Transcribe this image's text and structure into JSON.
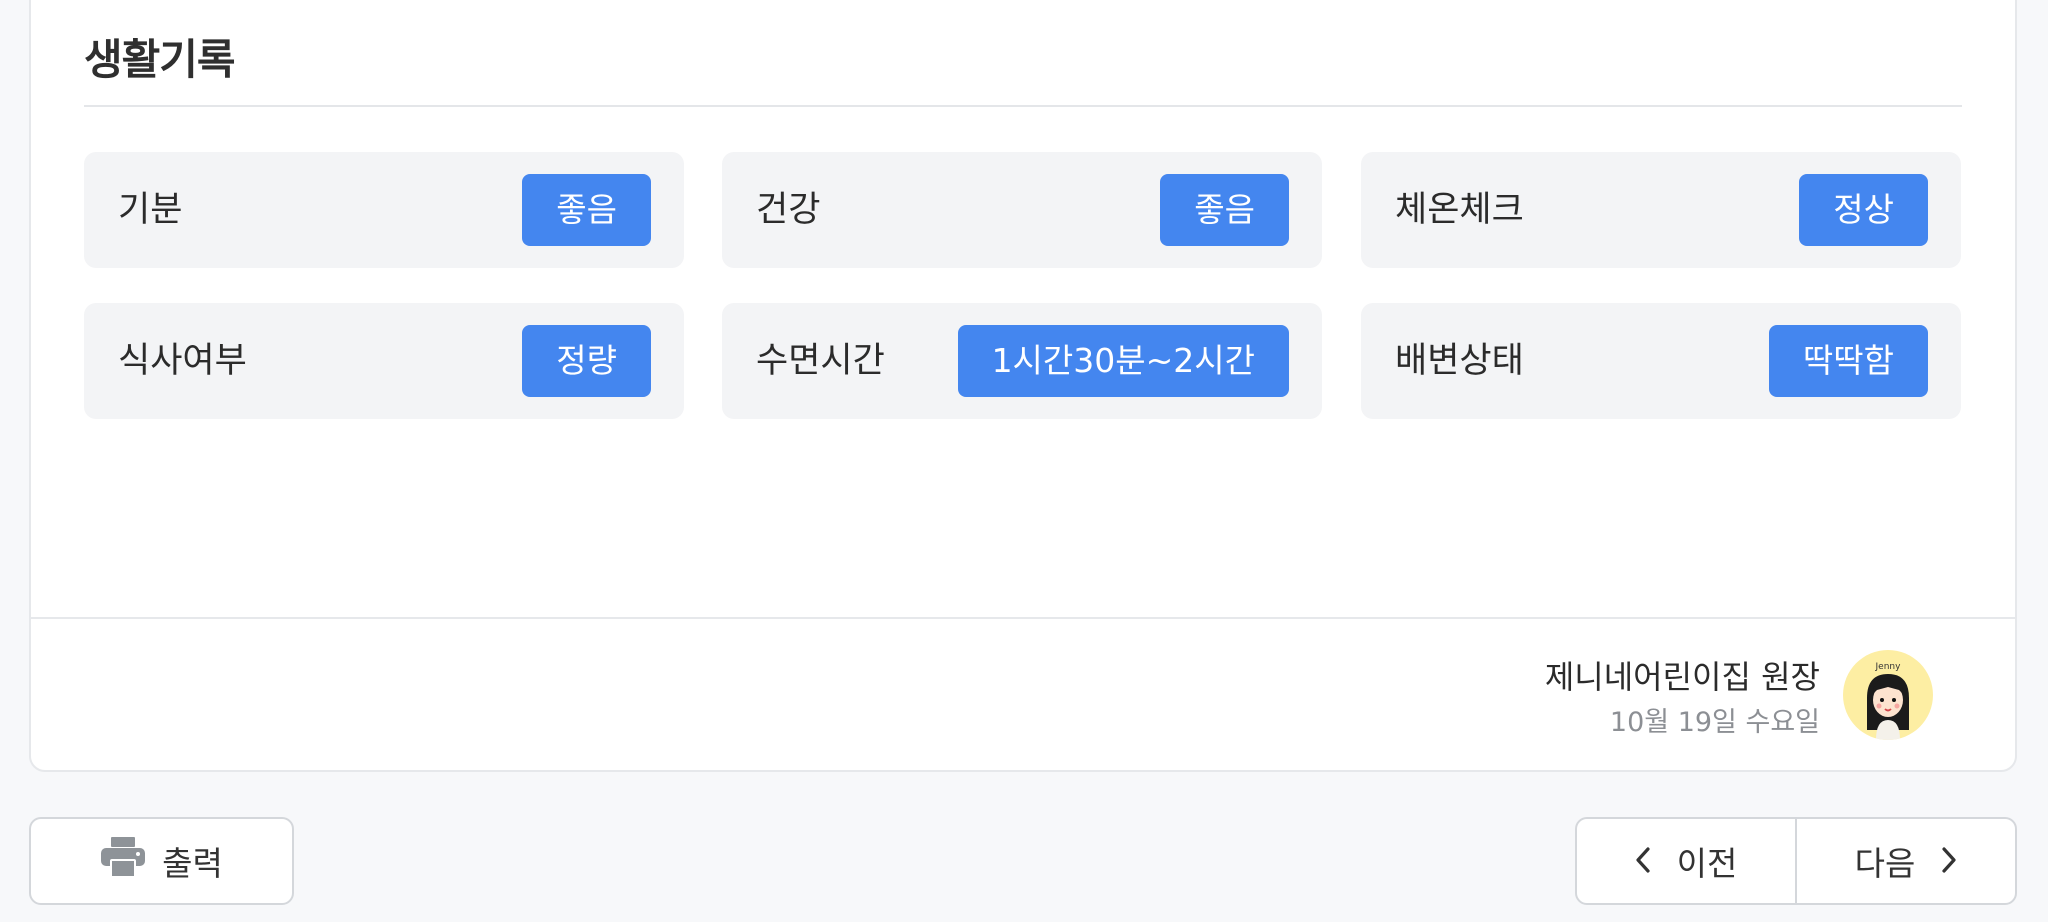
{
  "section": {
    "title": "생활기록"
  },
  "records": [
    {
      "label": "기분",
      "value": "좋음"
    },
    {
      "label": "건강",
      "value": "좋음"
    },
    {
      "label": "체온체크",
      "value": "정상"
    },
    {
      "label": "식사여부",
      "value": "정량"
    },
    {
      "label": "수면시간",
      "value": "1시간30분~2시간"
    },
    {
      "label": "배변상태",
      "value": "딱딱함"
    }
  ],
  "author": {
    "name": "제니네어린이집 원장",
    "date": "10월 19일 수요일",
    "avatar_text": "Jenny"
  },
  "actions": {
    "print_label": "출력",
    "prev_label": "이전",
    "next_label": "다음"
  },
  "colors": {
    "badge": "#4486ef",
    "tile_bg": "#f3f4f6",
    "avatar_bg": "#fdeea3"
  },
  "icons": [
    "printer-icon",
    "chevron-left-icon",
    "chevron-right-icon"
  ]
}
